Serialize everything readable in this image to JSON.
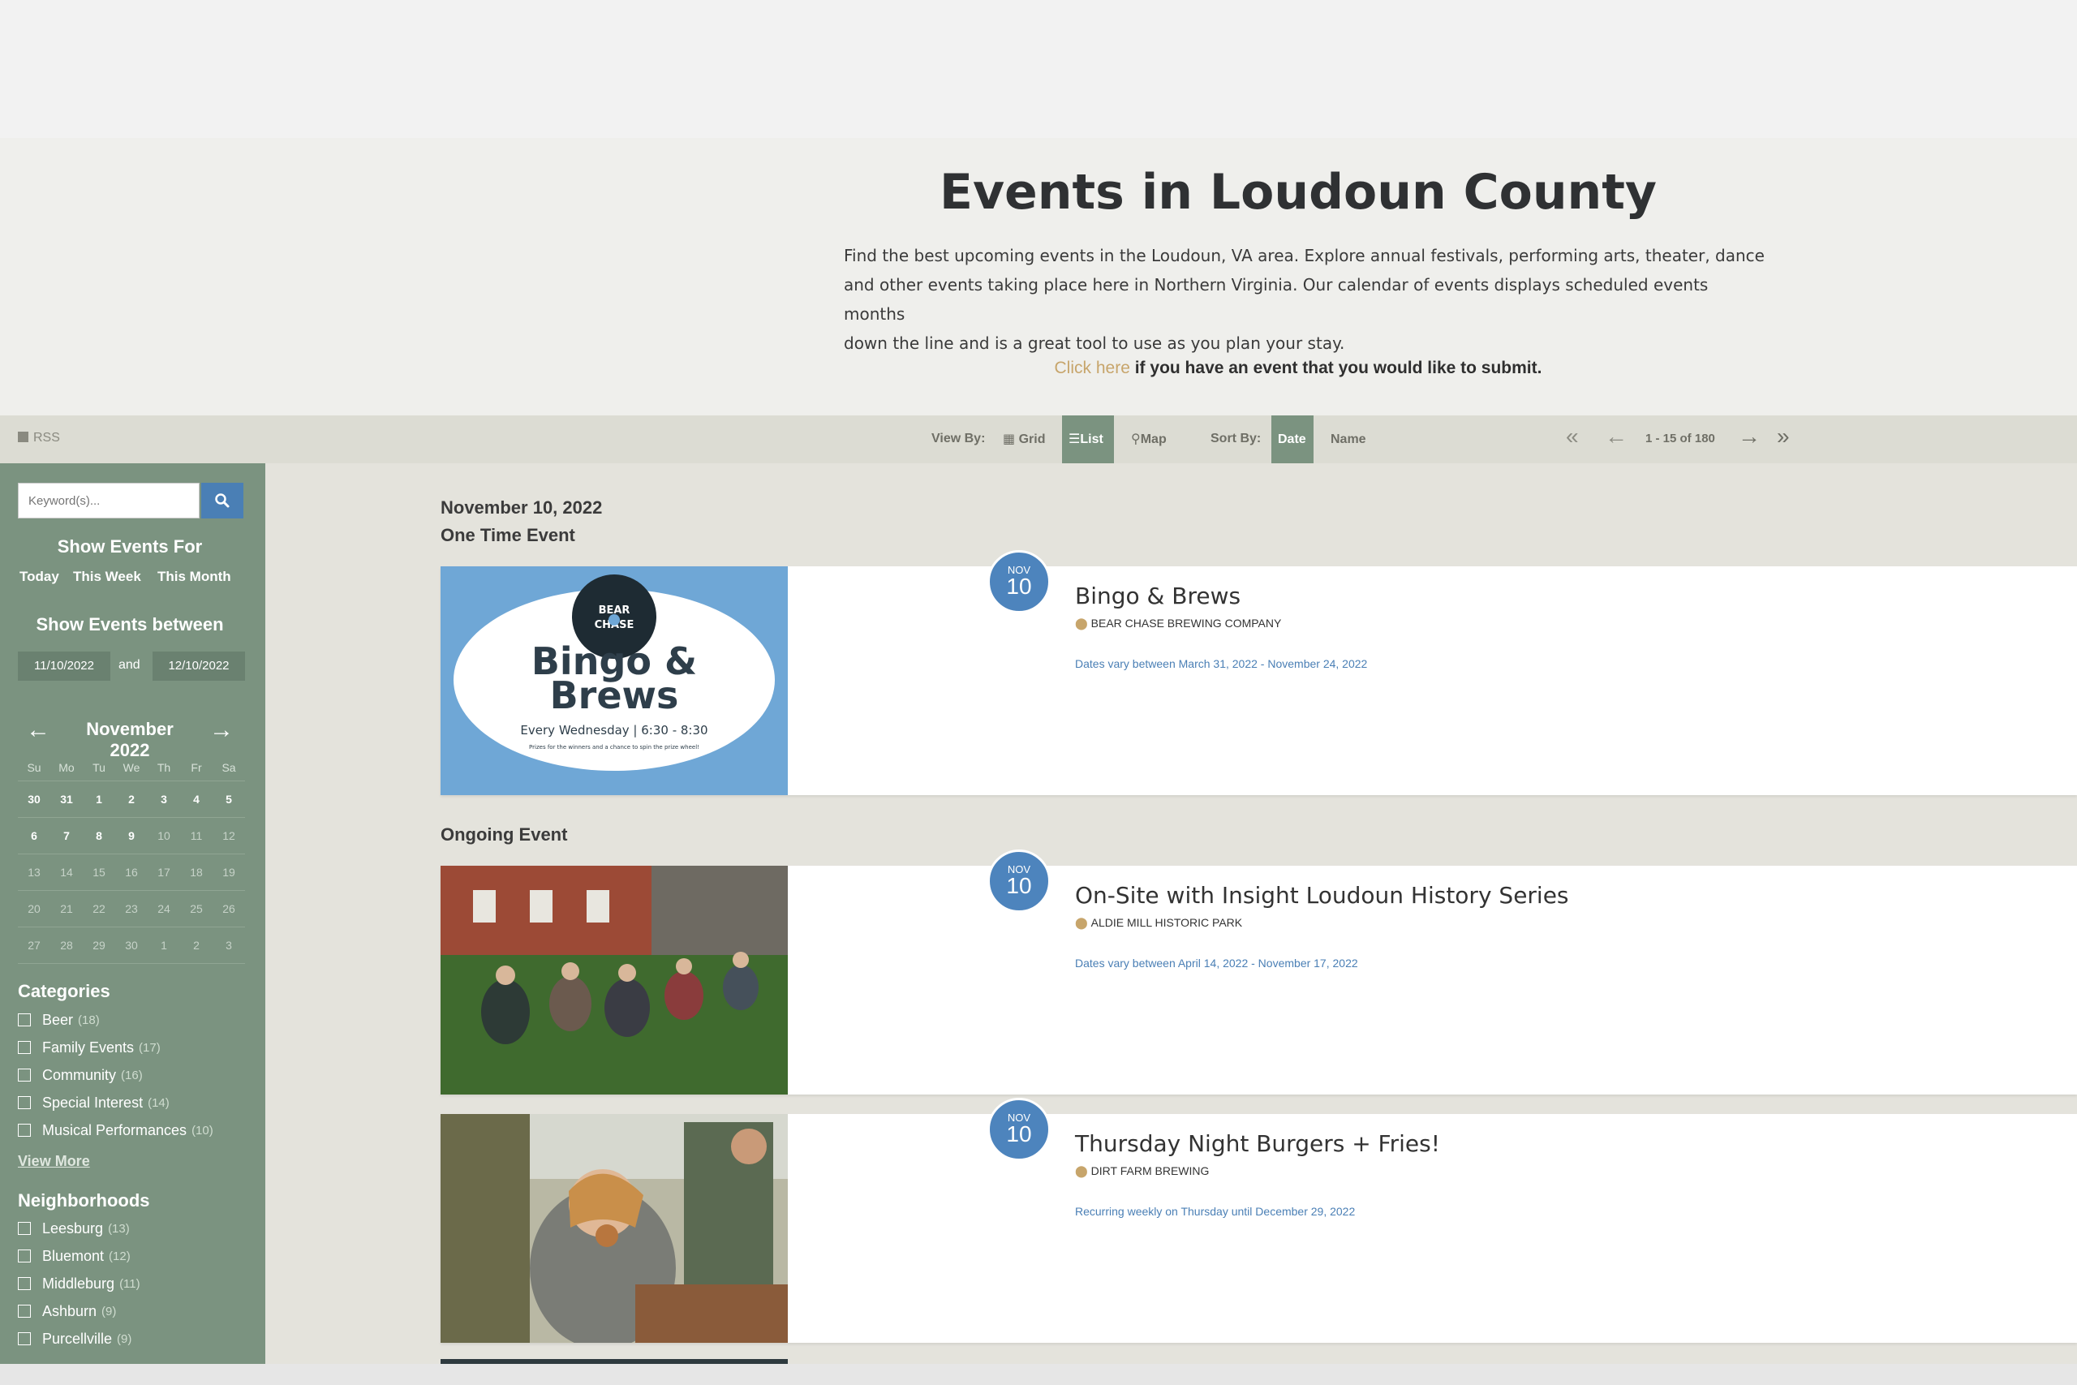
{
  "hero": {
    "title": "Events in Loudoun County",
    "intro_lines": [
      "Find the best upcoming events in the Loudoun, VA area. Explore annual festivals, performing arts, theater, dance",
      "and other events taking place here in Northern Virginia. Our calendar of events displays scheduled events months",
      "down the line and is a great tool to use as you plan your stay."
    ],
    "submit_link": "Click here",
    "submit_text": " if you have an event that you would like to submit."
  },
  "toolbar": {
    "rss": "RSS",
    "view_by_label": "View By:",
    "view_options": [
      "Grid",
      "List",
      "Map"
    ],
    "view_selected": "List",
    "sort_by_label": "Sort By:",
    "sort_options": [
      "Date",
      "Name"
    ],
    "sort_selected": "Date",
    "pagination_text": "1 - 15 of 180"
  },
  "sidebar": {
    "search_placeholder": "Keyword(s)...",
    "show_events_for": "Show Events For",
    "quick_links": [
      "Today",
      "This Week",
      "This Month"
    ],
    "show_events_between": "Show Events between",
    "start_date": "11/10/2022",
    "and_label": "and",
    "end_date": "12/10/2022",
    "calendar": {
      "month_label": "November 2022",
      "weekdays": [
        "Su",
        "Mo",
        "Tu",
        "We",
        "Th",
        "Fr",
        "Sa"
      ],
      "weeks": [
        [
          "30",
          "31",
          "1",
          "2",
          "3",
          "4",
          "5"
        ],
        [
          "6",
          "7",
          "8",
          "9",
          "10",
          "11",
          "12"
        ],
        [
          "13",
          "14",
          "15",
          "16",
          "17",
          "18",
          "19"
        ],
        [
          "20",
          "21",
          "22",
          "23",
          "24",
          "25",
          "26"
        ],
        [
          "27",
          "28",
          "29",
          "30",
          "1",
          "2",
          "3"
        ]
      ]
    },
    "categories_title": "Categories",
    "categories": [
      {
        "label": "Beer",
        "count": "(18)"
      },
      {
        "label": "Family Events",
        "count": "(17)"
      },
      {
        "label": "Community",
        "count": "(16)"
      },
      {
        "label": "Special Interest",
        "count": "(14)"
      },
      {
        "label": "Musical Performances",
        "count": "(10)"
      }
    ],
    "view_more": "View More",
    "neighborhoods_title": "Neighborhoods",
    "neighborhoods": [
      {
        "label": "Leesburg",
        "count": "(13)"
      },
      {
        "label": "Bluemont",
        "count": "(12)"
      },
      {
        "label": "Middleburg",
        "count": "(11)"
      },
      {
        "label": "Ashburn",
        "count": "(9)"
      },
      {
        "label": "Purcellville",
        "count": "(9)"
      }
    ]
  },
  "main": {
    "date_heading": "November 10, 2022",
    "group_one_time": "One Time Event",
    "group_ongoing": "Ongoing Event",
    "events": [
      {
        "month": "NOV",
        "day": "10",
        "title": "Bingo & Brews",
        "venue": "BEAR CHASE BREWING COMPANY",
        "dates": "Dates vary between March 31, 2022 - November 24, 2022",
        "thumb_logo": "BEAR CHASE",
        "thumb_title_1": "Bingo &",
        "thumb_title_2": "Brews",
        "thumb_sub": "Every Wednesday | 6:30 - 8:30",
        "thumb_small": "Prizes for the winners and a chance to spin the prize wheel!"
      },
      {
        "month": "NOV",
        "day": "10",
        "title": "On-Site with Insight Loudoun History Series",
        "venue": "ALDIE MILL HISTORIC PARK",
        "dates": "Dates vary between April 14, 2022 - November 17, 2022"
      },
      {
        "month": "NOV",
        "day": "10",
        "title": "Thursday Night Burgers + Fries!",
        "venue": "DIRT FARM BREWING",
        "dates": "Recurring weekly on Thursday until December 29, 2022"
      }
    ]
  },
  "colors": {
    "sidebar": "#7b9380",
    "accent_blue": "#4d84bd",
    "gold_link": "#c7a56b",
    "toolbar": "#dcdcd3"
  }
}
